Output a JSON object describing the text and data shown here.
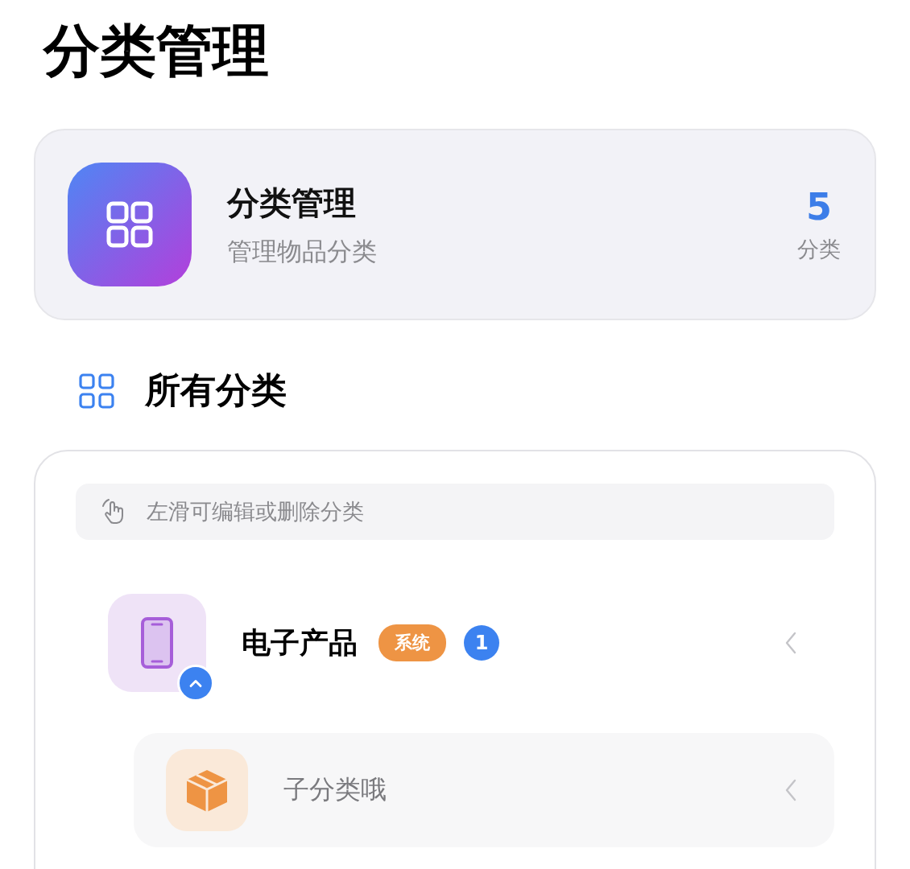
{
  "page_title": "分类管理",
  "summary": {
    "title": "分类管理",
    "subtitle": "管理物品分类",
    "count": "5",
    "count_label": "分类"
  },
  "section": {
    "title": "所有分类"
  },
  "hint": "左滑可编辑或删除分类",
  "categories": [
    {
      "name": "电子产品",
      "kind": "phone",
      "tag": "系统",
      "count": "1",
      "expanded": true,
      "children": [
        {
          "name": "子分类哦",
          "kind": "box"
        }
      ]
    }
  ]
}
